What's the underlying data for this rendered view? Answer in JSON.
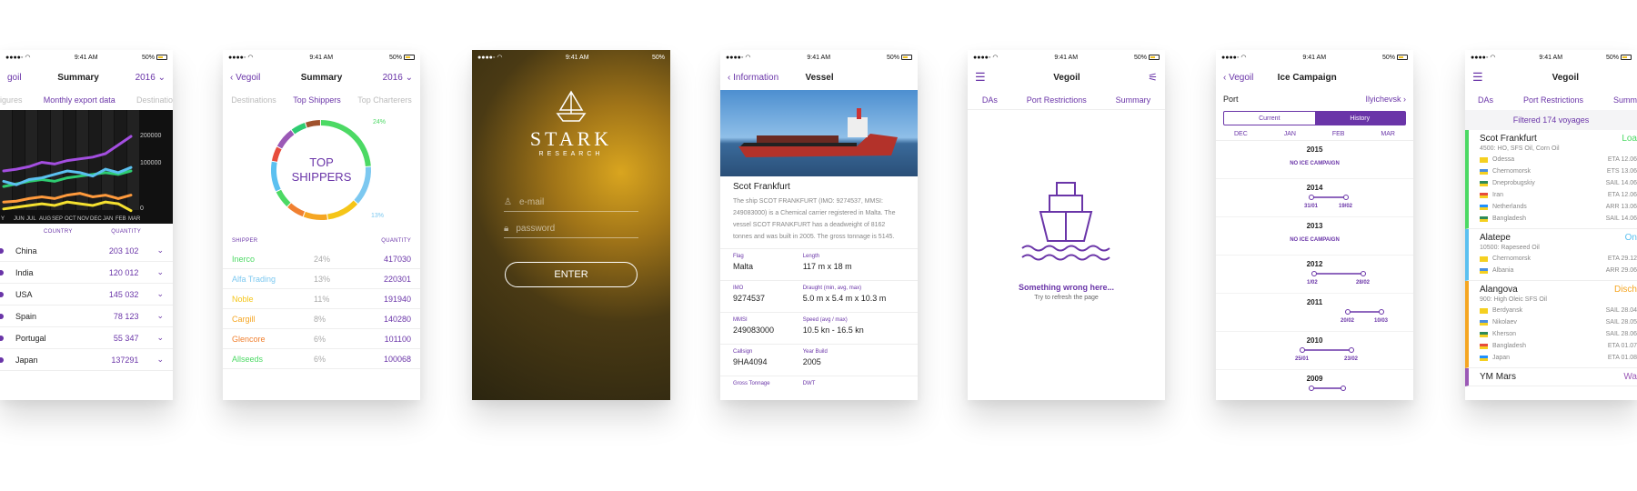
{
  "status": {
    "time": "9:41 AM",
    "battery": "50%"
  },
  "s1": {
    "back": "goil",
    "title": "Summary",
    "year": "2016",
    "tabs": [
      "igures",
      "Monthly export data",
      "Destinatio"
    ],
    "ticks_y": [
      "200000",
      "100000",
      "0"
    ],
    "months": [
      "Y",
      "JUN",
      "JUL",
      "AUG",
      "SEP",
      "OCT",
      "NOV",
      "DEC",
      "JAN",
      "FEB",
      "MAR"
    ],
    "col_country": "COUNTRY",
    "col_qty": "QUANTITY",
    "rows": [
      {
        "country": "China",
        "qty": "203 102"
      },
      {
        "country": "India",
        "qty": "120 012"
      },
      {
        "country": "USA",
        "qty": "145 032"
      },
      {
        "country": "Spain",
        "qty": "78 123"
      },
      {
        "country": "Portugal",
        "qty": "55 347"
      },
      {
        "country": "Japan",
        "qty": "137291"
      }
    ],
    "line_colors": [
      "#a34ee0",
      "#2ecc71",
      "#5bc0f0",
      "#ff9a3c",
      "#f5e130"
    ]
  },
  "s2": {
    "back": "Vegoil",
    "title": "Summary",
    "year": "2016",
    "tabs": [
      "Destinations",
      "Top Shippers",
      "Top Charterers"
    ],
    "donut_title": [
      "TOP",
      "SHIPPERS"
    ],
    "pct_top": "24%",
    "pct_bot": "13%",
    "col_shipper": "SHIPPER",
    "col_qty": "QUANTITY",
    "rows": [
      {
        "name": "Inerco",
        "pct": "24%",
        "qty": "417030",
        "color": "#4cd964"
      },
      {
        "name": "Alfa Trading",
        "pct": "13%",
        "qty": "220301",
        "color": "#7cc8f0"
      },
      {
        "name": "Noble",
        "pct": "11%",
        "qty": "191940",
        "color": "#f5c518"
      },
      {
        "name": "Cargill",
        "pct": "8%",
        "qty": "140280",
        "color": "#f5a623"
      },
      {
        "name": "Glencore",
        "pct": "6%",
        "qty": "101100",
        "color": "#f08030"
      },
      {
        "name": "Allseeds",
        "pct": "6%",
        "qty": "100068",
        "color": "#4cd964"
      }
    ]
  },
  "s3": {
    "brand": "STARK",
    "sub": "RESEARCH",
    "email_ph": "e-mail",
    "pass_ph": "password",
    "enter": "ENTER"
  },
  "s4": {
    "back": "Information",
    "title": "Vessel",
    "name": "Scot Frankfurt",
    "desc": "The ship SCOT FRANKFURT (IMO: 9274537, MMSI: 249083000) is a Chemical carrier registered in Malta. The vessel SCOT FRANKFURT has a deadweight of 8162 tonnes and was built in 2005. The gross tonnage is 5145.",
    "fields": [
      [
        "Flag",
        "Malta",
        "Length",
        "117 m x 18 m"
      ],
      [
        "IMO",
        "9274537",
        "Draught (min, avg, max)",
        "5.0 m x 5.4 m x 10.3 m"
      ],
      [
        "MMSI",
        "249083000",
        "Speed (avg / max)",
        "10.5 kn - 16.5 kn"
      ],
      [
        "Callsign",
        "9HA4094",
        "Year Build",
        "2005"
      ],
      [
        "Gross Tonnage",
        "",
        "DWT",
        ""
      ]
    ]
  },
  "s5": {
    "title": "Vegoil",
    "tabs": [
      "DAs",
      "Port Restrictions",
      "Summary"
    ],
    "err": "Something wrong here...",
    "hint": "Try to refresh the page"
  },
  "s6": {
    "back": "Vegoil",
    "title": "Ice Campaign",
    "port_label": "Port",
    "port": "Ilyichevsk",
    "seg": [
      "Current",
      "History"
    ],
    "months": [
      "DEC",
      "JAN",
      "FEB",
      "MAR"
    ],
    "years": [
      {
        "y": "2015",
        "note": "NO ICE CAMPAIGN"
      },
      {
        "y": "2014",
        "a": "31/01",
        "b": "19/02"
      },
      {
        "y": "2013",
        "note": "NO ICE CAMPAIGN"
      },
      {
        "y": "2012",
        "a": "1/02",
        "b": "28/02"
      },
      {
        "y": "2011",
        "a": "20/02",
        "b": "10/03"
      },
      {
        "y": "2010",
        "a": "25/01",
        "b": "23/02"
      },
      {
        "y": "2009"
      }
    ]
  },
  "s7": {
    "title": "Vegoil",
    "tabs": [
      "DAs",
      "Port Restrictions",
      "Summ"
    ],
    "filter": "Filtered 174 voyages",
    "cards": [
      {
        "name": "Scot Frankfurt",
        "status": "Loa",
        "desc": "4500: HO, SFS Oil, Corn Oil",
        "color": "#4cd964",
        "ports": [
          [
            "Odessa",
            "ETA 12.06"
          ],
          [
            "Chernomorsk",
            "ETS 13.06"
          ],
          [
            "Dneprobugskiy",
            "SAIL 14.06"
          ],
          [
            "Iran",
            "ETA 12.06"
          ],
          [
            "Netherlands",
            "ARR 13.06"
          ],
          [
            "Bangladesh",
            "SAIL 14.06"
          ]
        ]
      },
      {
        "name": "Alatepe",
        "status": "On",
        "desc": "10500: Rapeseed Oil",
        "color": "#5bc0f0",
        "ports": [
          [
            "Chernomorsk",
            "ETA 29.12"
          ],
          [
            "Albania",
            "ARR 29.06"
          ]
        ]
      },
      {
        "name": "Alangova",
        "status": "Disch",
        "desc": "900: High Oleic SFS Oil",
        "color": "#f5a623",
        "ports": [
          [
            "Berdyansk",
            "SAIL 28.04"
          ],
          [
            "Nikolaev",
            "SAIL 28.05"
          ],
          [
            "Kherson",
            "SAIL 28.06"
          ],
          [
            "Bangladesh",
            "ETA 01.07"
          ],
          [
            "Japan",
            "ETA 01.08"
          ]
        ]
      },
      {
        "name": "YM Mars",
        "status": "Wa",
        "desc": "",
        "color": "#9b59b6",
        "ports": []
      }
    ]
  }
}
